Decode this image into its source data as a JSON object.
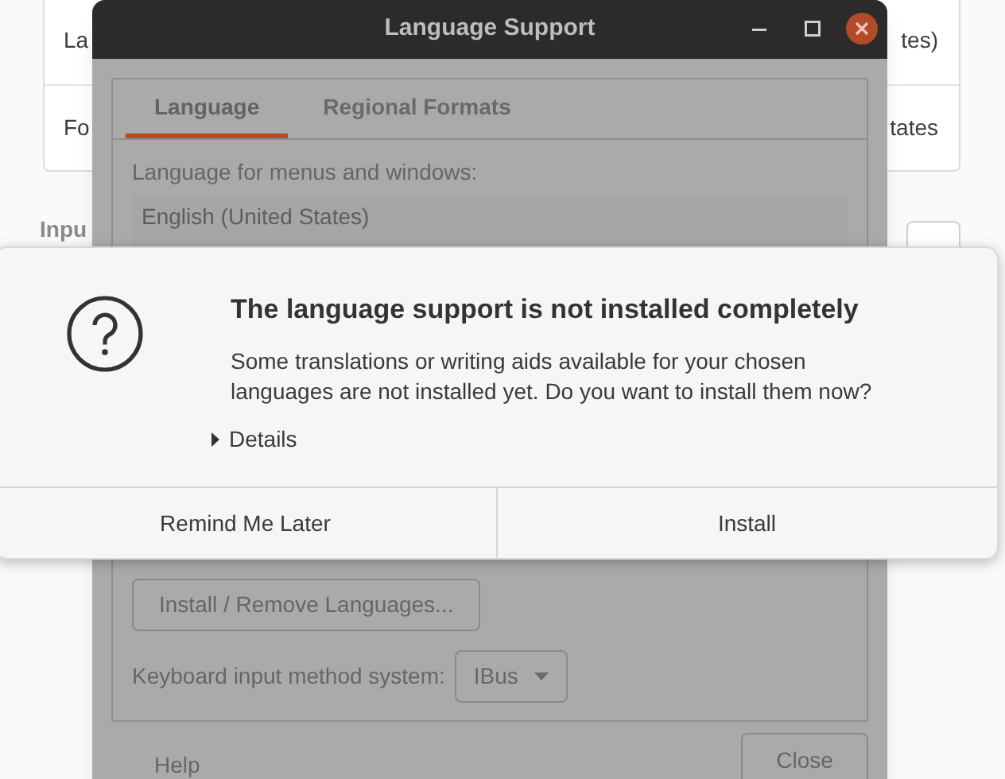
{
  "background": {
    "rows": [
      {
        "left": "La",
        "right": "tes)"
      },
      {
        "left": "Fo",
        "right": "tates"
      }
    ],
    "section_heading": "Inpu"
  },
  "window": {
    "title": "Language Support",
    "tabs": [
      {
        "label": "Language",
        "selected": true
      },
      {
        "label": "Regional Formats",
        "selected": false
      }
    ],
    "list_label": "Language for menus and windows:",
    "languages": [
      "English (United States)"
    ],
    "install_remove_button": "Install / Remove Languages...",
    "input_method_label": "Keyboard input method system:",
    "input_method_value": "IBus",
    "help_button": "Help",
    "close_button": "Close"
  },
  "alert": {
    "title": "The language support is not installed completely",
    "message": "Some translations or writing aids available for your chosen languages are not installed yet. Do you want to install them now?",
    "details": {
      "label": "Details",
      "expanded": false
    },
    "buttons": [
      "Remind Me Later",
      "Install"
    ]
  }
}
